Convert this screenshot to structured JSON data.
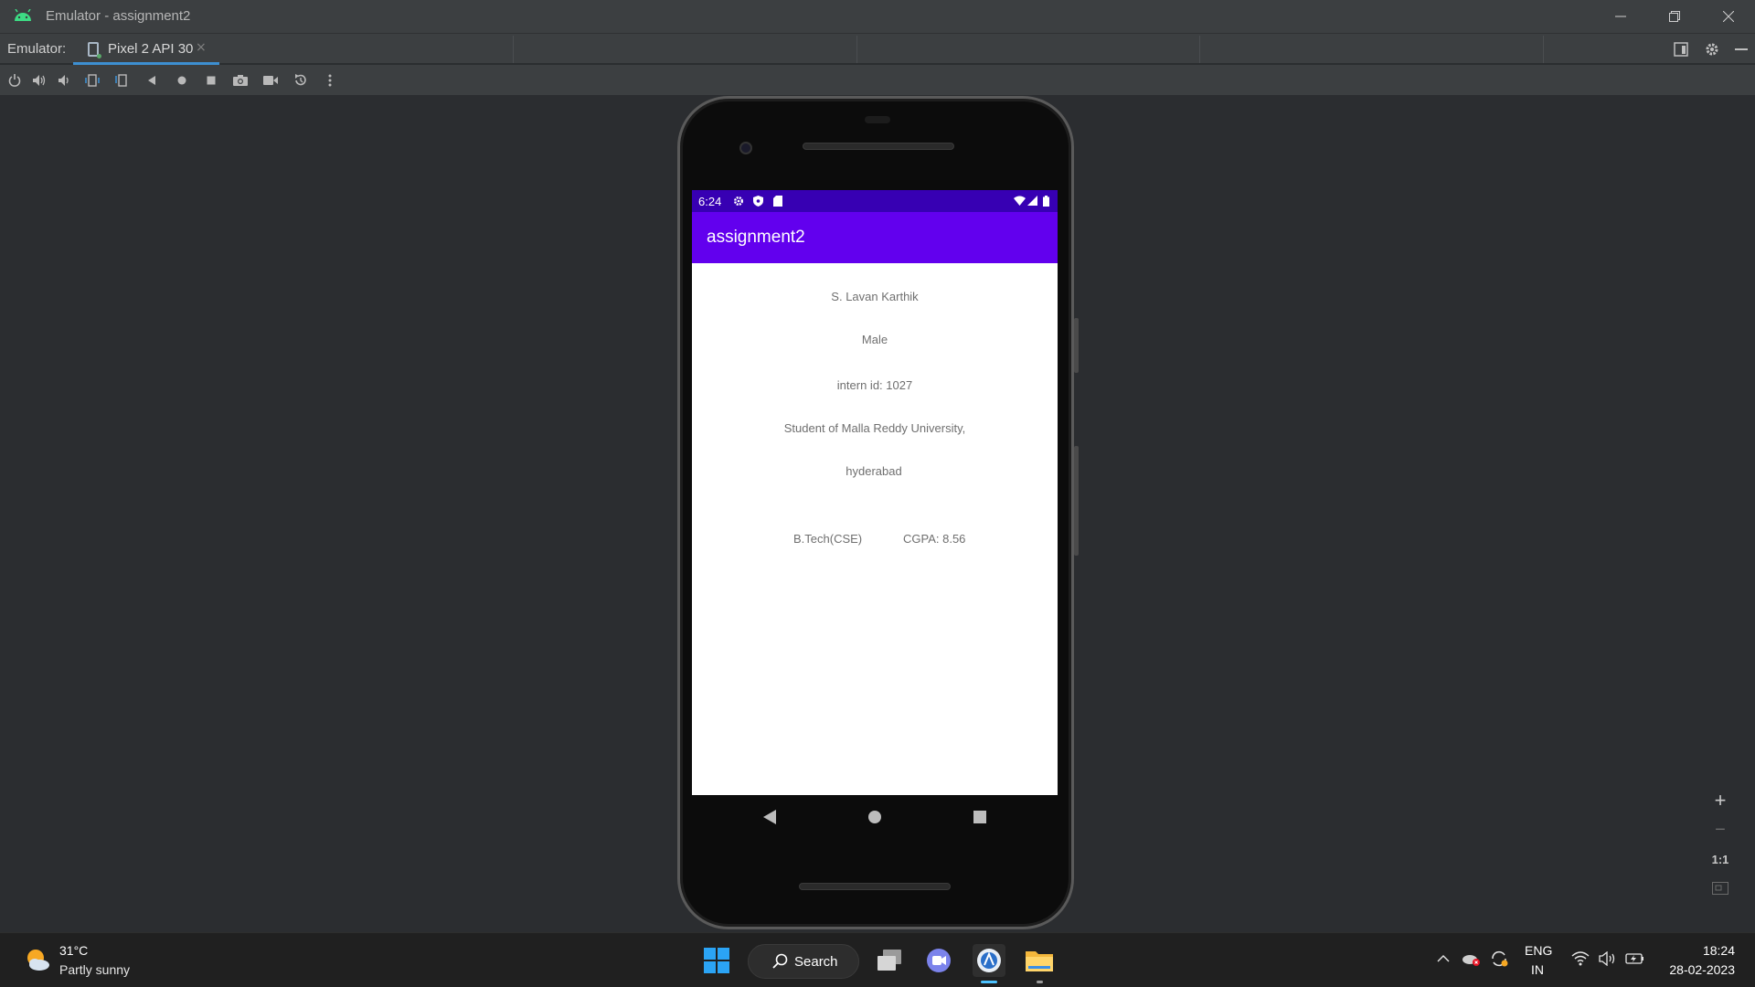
{
  "window": {
    "title": "Emulator - assignment2",
    "minimize_icon": "minimize-icon",
    "restore_icon": "restore-icon",
    "close_icon": "close-icon"
  },
  "tabbar": {
    "label": "Emulator:",
    "tab_label": "Pixel 2 API 30",
    "tab_close": "×"
  },
  "toolbar": {
    "icons": [
      "power-icon",
      "volume-up-icon",
      "volume-down-icon",
      "rotate-left-icon",
      "rotate-right-icon",
      "back-icon",
      "home-icon",
      "overview-icon",
      "screenshot-icon",
      "screen-record-icon",
      "snapshot-icon",
      "more-icon"
    ]
  },
  "device": {
    "status_time": "6:24",
    "app_title": "assignment2",
    "content": {
      "name": "S. Lavan Karthik",
      "gender": "Male",
      "intern_id": "intern id: 1027",
      "university": "Student of Malla Reddy University,",
      "city": "hyderabad",
      "degree": "B.Tech(CSE)",
      "cgpa": "CGPA: 8.56"
    }
  },
  "zoom": {
    "zoom_in": "+",
    "zoom_out": "−",
    "one_to_one": "1:1"
  },
  "taskbar": {
    "temperature": "31°C",
    "condition": "Partly sunny",
    "search_label": "Search",
    "lang_line1": "ENG",
    "lang_line2": "IN",
    "time": "18:24",
    "date": "28-02-2023"
  },
  "colors": {
    "status_bar": "#3700b3",
    "app_bar": "#6200ee",
    "ide_background": "#2b2d30",
    "taskbar": "#202020"
  }
}
